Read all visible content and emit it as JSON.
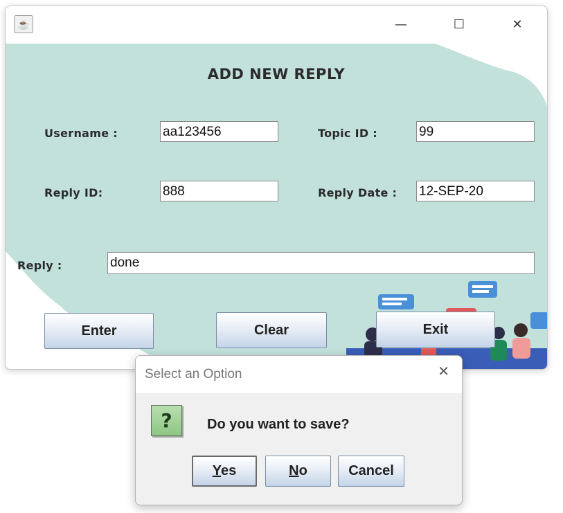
{
  "window": {
    "title": "",
    "controls": [
      "minimize-icon",
      "maximize-icon",
      "close-icon"
    ],
    "icon": "java-cup-icon"
  },
  "form": {
    "heading": "ADD NEW REPLY",
    "username_label": "Username :",
    "username_value": "aa123456",
    "topic_id_label": "Topic ID :",
    "topic_id_value": "99",
    "reply_id_label": "Reply ID:",
    "reply_id_value": "888",
    "reply_date_label": "Reply Date :",
    "reply_date_value": "12-SEP-20",
    "reply_label": "Reply :",
    "reply_value": "done"
  },
  "buttons": {
    "enter": "Enter",
    "clear": "Clear",
    "exit": "Exit"
  },
  "dialog": {
    "title": "Select an Option",
    "message": "Do you want to save?",
    "icon": "question-icon",
    "yes_mnemonic": "Y",
    "yes_rest": "es",
    "no_mnemonic": "N",
    "no_rest": "o",
    "cancel": "Cancel"
  },
  "colors": {
    "background_blob": "#c2e1db",
    "button_gradient_bottom": "#c4d4e8",
    "question_icon": "#8ec684"
  }
}
